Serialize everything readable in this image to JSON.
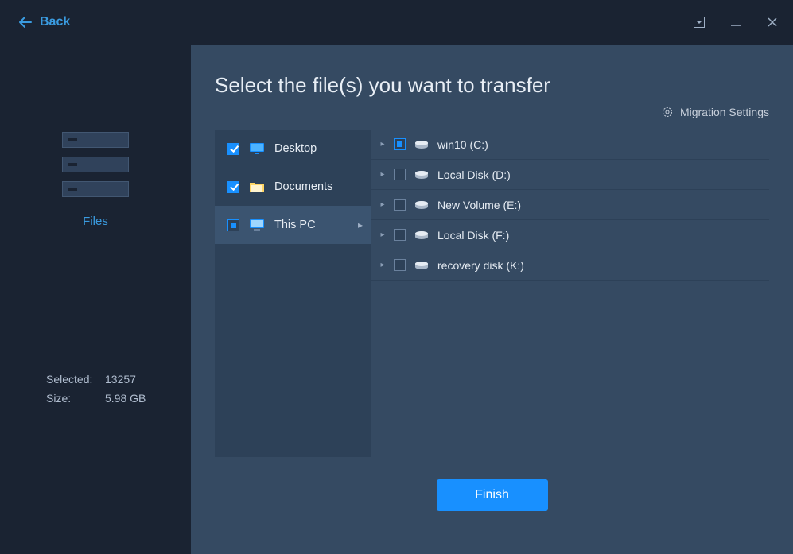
{
  "titlebar": {
    "back_label": "Back"
  },
  "sidebar": {
    "label": "Files",
    "stats": {
      "selected_label": "Selected:",
      "selected_value": "13257",
      "size_label": "Size:",
      "size_value": "5.98 GB"
    }
  },
  "content": {
    "title": "Select the file(s) you want to transfer",
    "settings_label": "Migration Settings",
    "finish_label": "Finish",
    "left_items": [
      {
        "label": "Desktop",
        "check": "checked",
        "icon": "desktop",
        "selected": false
      },
      {
        "label": "Documents",
        "check": "checked",
        "icon": "folder",
        "selected": false
      },
      {
        "label": "This PC",
        "check": "partial",
        "icon": "pc",
        "selected": true
      }
    ],
    "right_items": [
      {
        "label": "win10 (C:)",
        "check": "partial"
      },
      {
        "label": "Local Disk (D:)",
        "check": "none"
      },
      {
        "label": "New Volume (E:)",
        "check": "none"
      },
      {
        "label": "Local Disk (F:)",
        "check": "none"
      },
      {
        "label": "recovery disk (K:)",
        "check": "none"
      }
    ]
  }
}
